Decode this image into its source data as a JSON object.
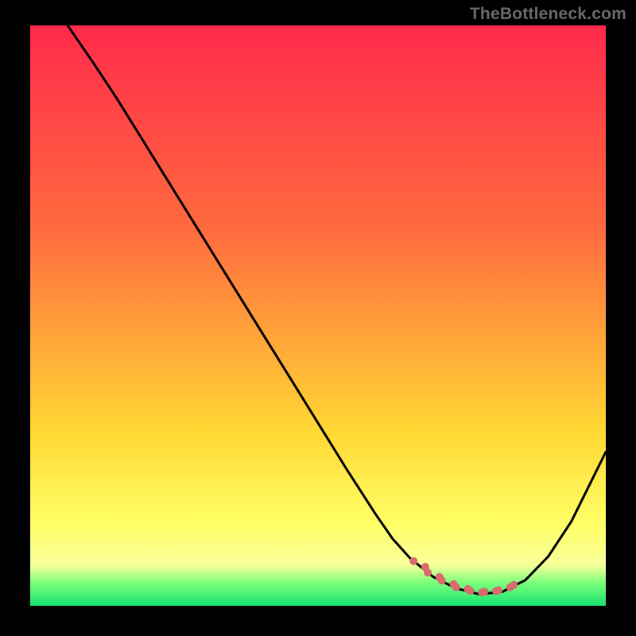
{
  "watermark": "TheBottleneck.com",
  "colors": {
    "page_bg": "#000000",
    "gradient_top": "#ff2a4b",
    "gradient_mid1": "#ff8a3a",
    "gradient_mid2": "#ffe733",
    "gradient_low": "#f8ff9a",
    "gradient_base": "#15e36e",
    "curve": "#000000",
    "dots": "#d86b6b"
  },
  "chart_data": {
    "type": "line",
    "title": "",
    "xlabel": "",
    "ylabel": "",
    "xlim": [
      0,
      100
    ],
    "ylim": [
      0,
      100
    ],
    "grid": false,
    "legend": false,
    "series": [
      {
        "name": "curve",
        "x": [
          6.5,
          11,
          12,
          15,
          20,
          25,
          30,
          35,
          40,
          45,
          50,
          55,
          60,
          63,
          66,
          70,
          74,
          78,
          82,
          86,
          90,
          94,
          100
        ],
        "y": [
          100,
          93.5,
          92,
          87.5,
          79.5,
          71.5,
          63.5,
          55.5,
          47.5,
          39.5,
          31.5,
          23.5,
          15.8,
          11.5,
          8.2,
          5.0,
          3.0,
          2.0,
          2.4,
          4.4,
          8.5,
          14.5,
          26.5
        ]
      }
    ],
    "markers": {
      "name": "optimal-range-dots",
      "x_start": 67,
      "x_end": 83,
      "y_approx": 3.0,
      "count_approx": 14
    },
    "gradient_background": {
      "stops_pct": [
        0,
        35,
        70,
        86,
        93,
        96,
        100
      ],
      "colors": [
        "#ff2a4b",
        "#ff6a3f",
        "#ffd733",
        "#ffff66",
        "#f8ff9a",
        "#7cff7c",
        "#15e36e"
      ]
    }
  }
}
